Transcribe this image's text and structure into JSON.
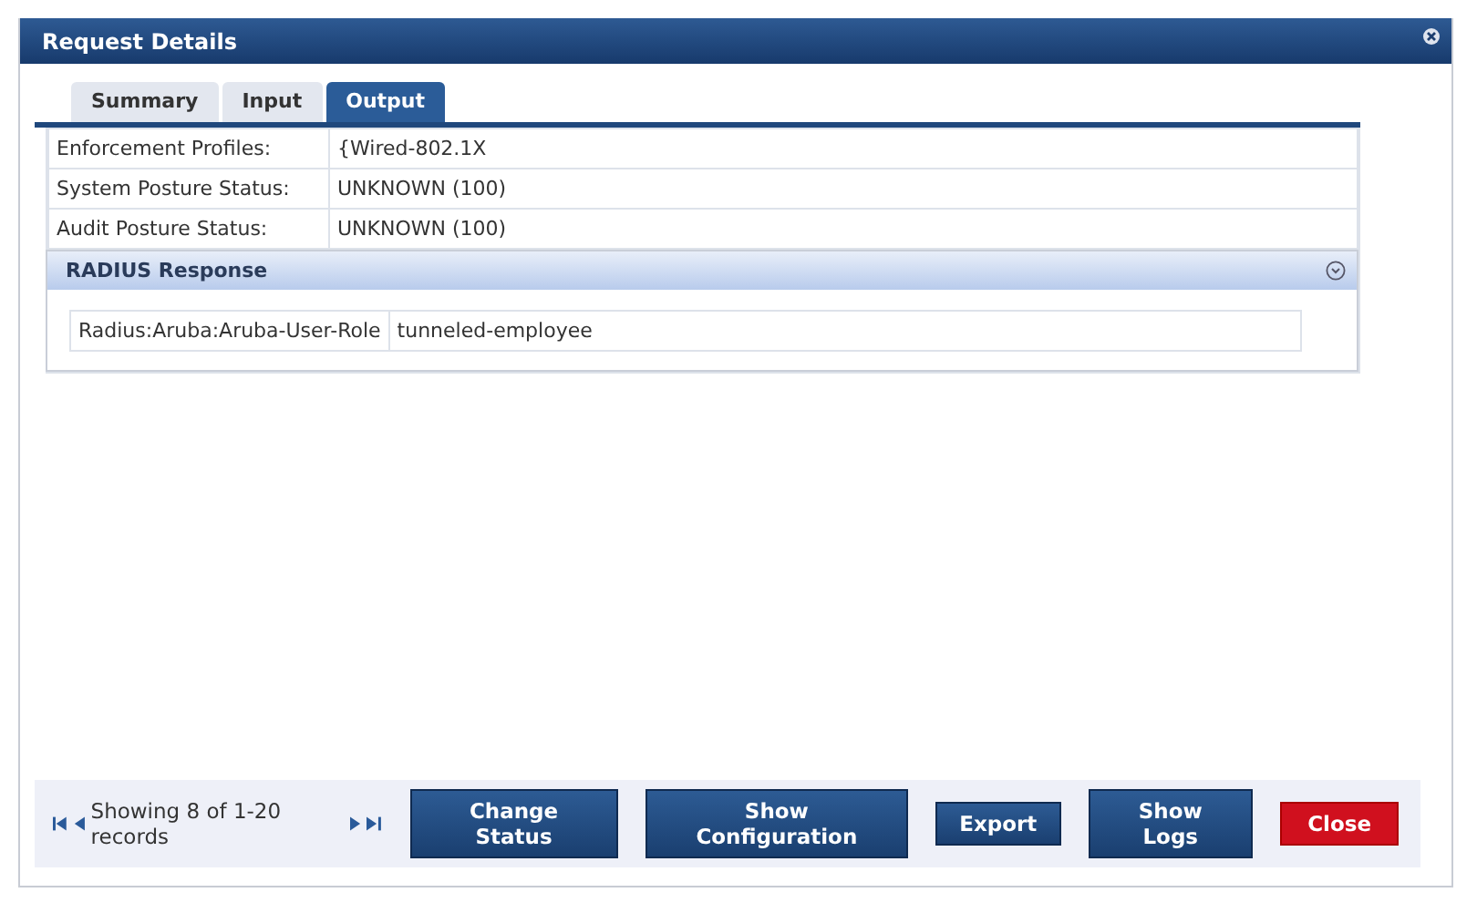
{
  "window": {
    "title": "Request Details"
  },
  "tabs": [
    {
      "label": "Summary",
      "selected": false
    },
    {
      "label": "Input",
      "selected": false
    },
    {
      "label": "Output",
      "selected": true
    }
  ],
  "fields": [
    {
      "label": "Enforcement Profiles:",
      "value": "{Wired-802.1X"
    },
    {
      "label": "System Posture Status:",
      "value": "UNKNOWN (100)"
    },
    {
      "label": "Audit Posture Status:",
      "value": "UNKNOWN (100)"
    }
  ],
  "radius_response": {
    "title": "RADIUS Response",
    "expanded": true,
    "rows": [
      {
        "attribute": "Radius:Aruba:Aruba-User-Role",
        "value": "tunneled-employee"
      }
    ]
  },
  "pager": {
    "text": "Showing 8 of 1-20 records"
  },
  "buttons": [
    {
      "label": "Change Status",
      "kind": "primary"
    },
    {
      "label": "Show Configuration",
      "kind": "primary"
    },
    {
      "label": "Export",
      "kind": "primary"
    },
    {
      "label": "Show Logs",
      "kind": "primary"
    },
    {
      "label": "Close",
      "kind": "danger"
    }
  ]
}
